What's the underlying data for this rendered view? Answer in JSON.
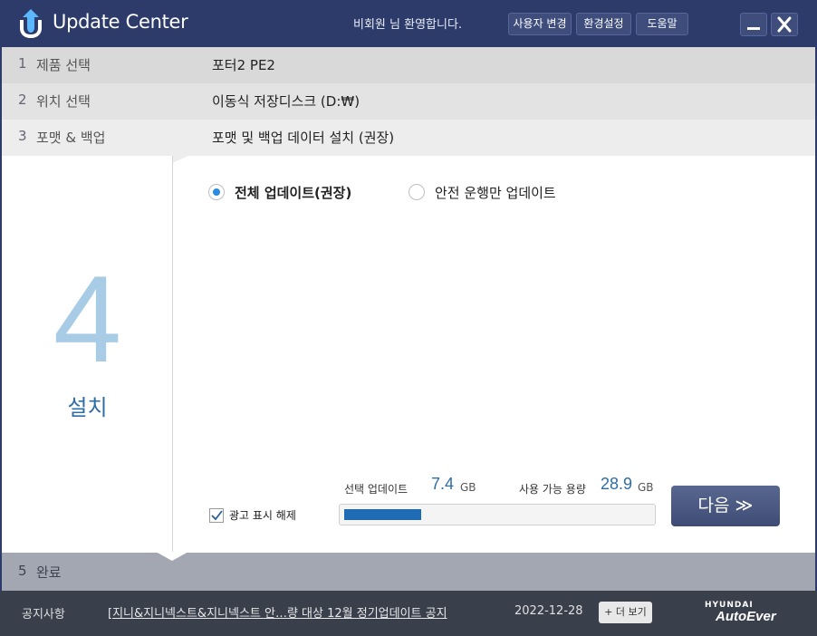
{
  "app": {
    "title": "Update Center",
    "welcome": "비회원  님 환영합니다.",
    "buttons": {
      "user_change": "사용자 변경",
      "settings": "환경설정",
      "help": "도움말"
    }
  },
  "steps": [
    {
      "num": "1",
      "label": "제품 선택",
      "value": "포터2 PE2"
    },
    {
      "num": "2",
      "label": "위치 선택",
      "value": "이동식 저장디스크 (D:₩)"
    },
    {
      "num": "3",
      "label": "포맷 & 백업",
      "value": "포맷 및 백업 데이터 설치 (권장)"
    }
  ],
  "current_step": {
    "num": "4",
    "label": "설치"
  },
  "options": {
    "full_update": "전체 업데이트(권장)",
    "safety_update": "안전 운행만 업데이트",
    "selected": "full_update"
  },
  "ad_checkbox": {
    "label": "광고 표시 해제",
    "checked": true
  },
  "stats": {
    "selected_label": "선택 업데이트",
    "selected_value": "7.4",
    "selected_unit": "GB",
    "available_label": "사용 가능 용량",
    "available_value": "28.9",
    "available_unit": "GB",
    "progress_fraction": 0.25
  },
  "next_button": {
    "label": "다음 ≫"
  },
  "step5": {
    "num": "5",
    "label": "완료"
  },
  "footer": {
    "notice_title": "공지사항",
    "notice_text": "[지니&지니넥스트&지니넥스트  안…량 대상 12월 정기업데이트 공지",
    "date": "2022-12-28",
    "more": "+ 더 보기",
    "brand_top": "HYUNDAI",
    "brand_bottom": "AutoEver"
  },
  "colors": {
    "titlebar": "#2c3b6a",
    "accent": "#2f6da5",
    "progress": "#1f6cb5",
    "footer": "#3a3f4c"
  },
  "icons": {
    "logo": "update-center-logo-icon",
    "minimize": "minimize-icon",
    "close": "close-icon",
    "check": "checkmark-icon"
  }
}
